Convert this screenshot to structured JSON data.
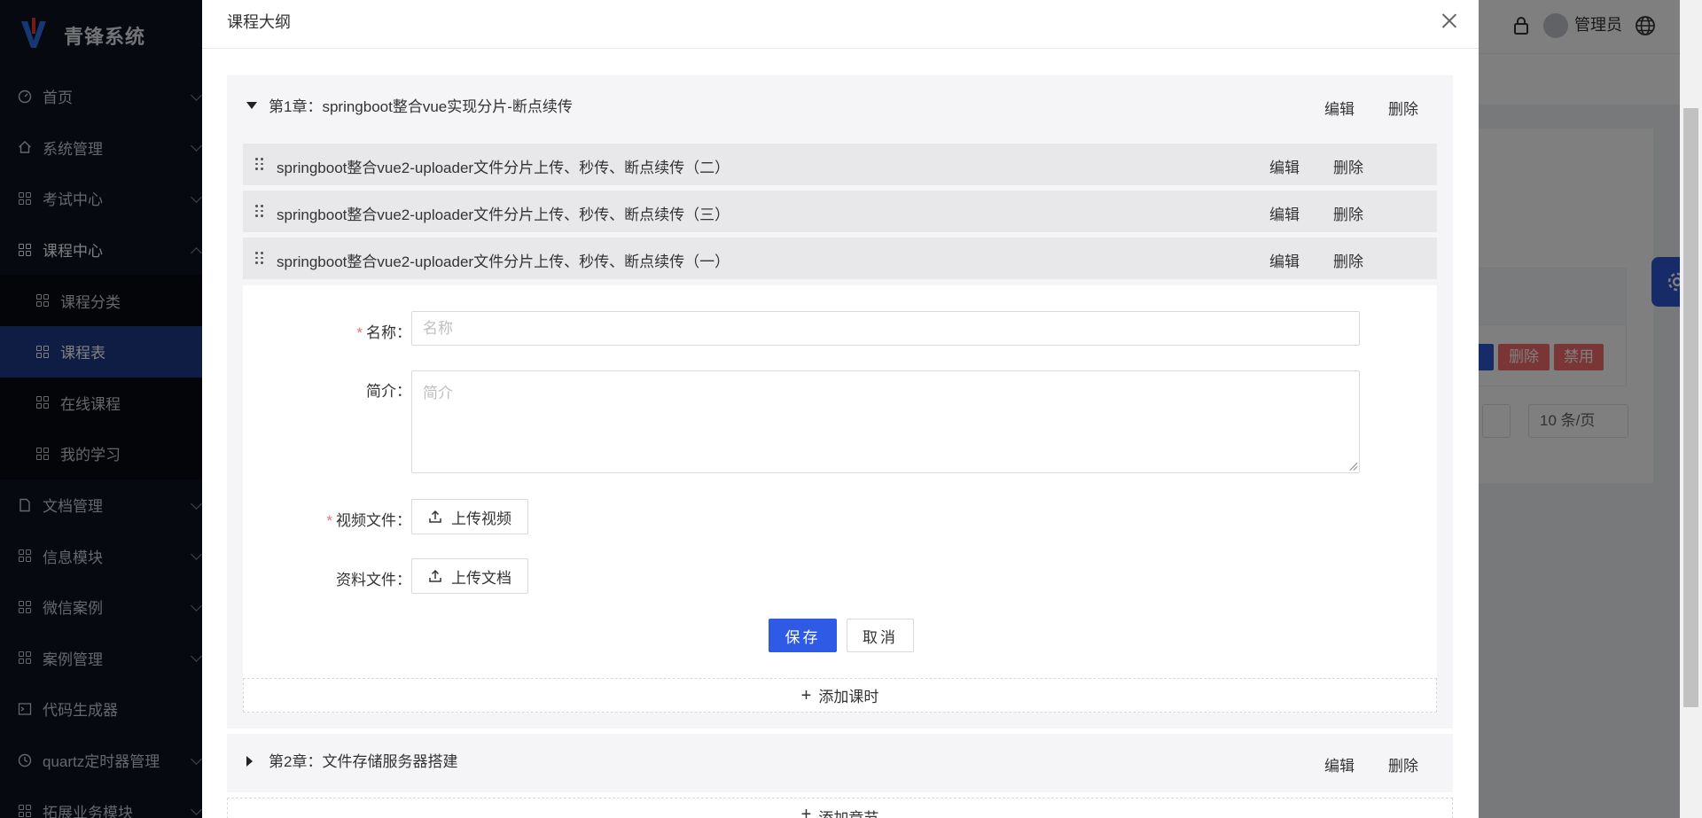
{
  "app": {
    "name": "青锋系统"
  },
  "sidebar": {
    "items": [
      {
        "label": "首页",
        "icon": "dashboard-icon"
      },
      {
        "label": "系统管理",
        "icon": "home-icon"
      },
      {
        "label": "考试中心",
        "icon": "grid-icon"
      },
      {
        "label": "课程中心",
        "icon": "grid-icon",
        "expanded": true
      },
      {
        "label": "文档管理",
        "icon": "document-icon"
      },
      {
        "label": "信息模块",
        "icon": "grid-icon"
      },
      {
        "label": "微信案例",
        "icon": "grid-icon"
      },
      {
        "label": "案例管理",
        "icon": "grid-icon"
      },
      {
        "label": "代码生成器",
        "icon": "terminal-icon"
      },
      {
        "label": "quartz定时器管理",
        "icon": "clock-icon"
      },
      {
        "label": "拓展业务模块",
        "icon": "grid-icon"
      }
    ],
    "course_sub": [
      {
        "label": "课程分类"
      },
      {
        "label": "课程表",
        "active": true
      },
      {
        "label": "在线课程"
      },
      {
        "label": "我的学习"
      }
    ]
  },
  "header": {
    "user": "管理员"
  },
  "background": {
    "row_buttons": [
      "删除",
      "禁用"
    ],
    "page_size": "10 条/页"
  },
  "dialog": {
    "title": "课程大纲",
    "chapters": [
      {
        "title": "第1章：springboot整合vue实现分片-断点续传",
        "expanded": true,
        "edit_label": "编辑",
        "delete_label": "删除",
        "lessons": [
          {
            "title": "springboot整合vue2-uploader文件分片上传、秒传、断点续传（二）",
            "edit_label": "编辑",
            "delete_label": "删除"
          },
          {
            "title": "springboot整合vue2-uploader文件分片上传、秒传、断点续传（三）",
            "edit_label": "编辑",
            "delete_label": "删除"
          },
          {
            "title": "springboot整合vue2-uploader文件分片上传、秒传、断点续传（一）",
            "edit_label": "编辑",
            "delete_label": "删除"
          }
        ],
        "add_lesson_label": "添加课时"
      },
      {
        "title": "第2章：文件存储服务器搭建",
        "expanded": false,
        "edit_label": "编辑",
        "delete_label": "删除"
      }
    ],
    "add_chapter_label": "添加章节",
    "form": {
      "name_label": "名称：",
      "name_placeholder": "名称",
      "name_value": "",
      "intro_label": "简介：",
      "intro_placeholder": "简介",
      "intro_value": "",
      "video_label": "视频文件：",
      "video_button": "上传视频",
      "doc_label": "资料文件：",
      "doc_button": "上传文档",
      "save_label": "保存",
      "cancel_label": "取消",
      "required_mark": "*"
    }
  },
  "colors": {
    "primary": "#2f5ae6",
    "sidebar_bg": "#0d1420",
    "sidebar_active": "#1e3a8a",
    "danger": "#f56c6c"
  }
}
